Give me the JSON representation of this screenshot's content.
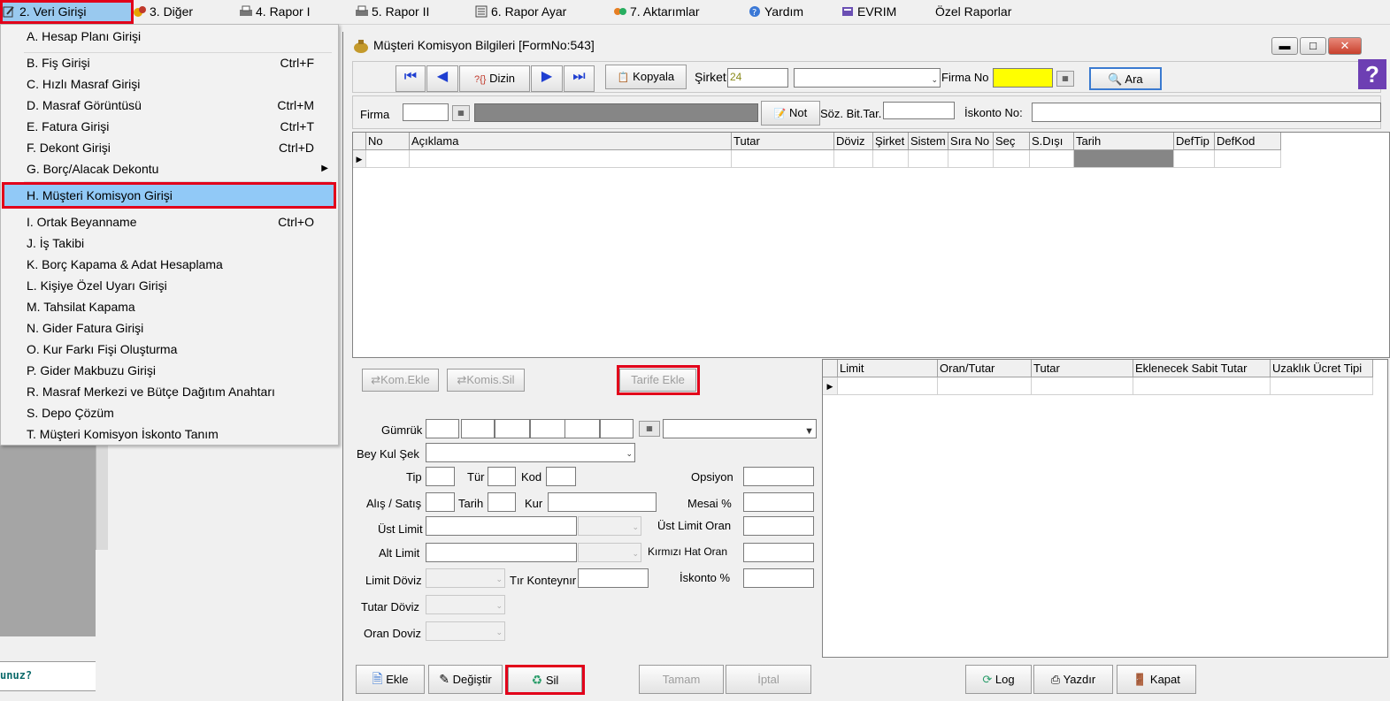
{
  "menubar": {
    "items": [
      {
        "label": "2.  Veri Girişi"
      },
      {
        "label": "3.  Diğer"
      },
      {
        "label": "4.   Rapor I"
      },
      {
        "label": "5.   Rapor II"
      },
      {
        "label": "6.   Rapor Ayar"
      },
      {
        "label": "7.   Aktarımlar"
      },
      {
        "label": "Yardım"
      },
      {
        "label": "EVRIM"
      },
      {
        "label": "Özel Raporlar"
      }
    ]
  },
  "menu": {
    "items": [
      {
        "label": "A.  Hesap Planı Girişi",
        "shortcut": ""
      },
      {
        "label": "B.  Fiş Girişi",
        "shortcut": "Ctrl+F"
      },
      {
        "label": "C.  Hızlı Masraf Girişi",
        "shortcut": ""
      },
      {
        "label": "D.  Masraf Görüntüsü",
        "shortcut": "Ctrl+M"
      },
      {
        "label": "E.   Fatura Girişi",
        "shortcut": "Ctrl+T"
      },
      {
        "label": "F.   Dekont Girişi",
        "shortcut": "Ctrl+D"
      },
      {
        "label": "G.  Borç/Alacak Dekontu",
        "shortcut": ""
      },
      {
        "label": "H.   Müşteri Komisyon Girişi",
        "shortcut": ""
      },
      {
        "label": "I.   Ortak Beyanname",
        "shortcut": "Ctrl+O"
      },
      {
        "label": "J.   İş Takibi",
        "shortcut": ""
      },
      {
        "label": "K.   Borç Kapama & Adat Hesaplama",
        "shortcut": ""
      },
      {
        "label": "L.   Kişiye Özel Uyarı Girişi",
        "shortcut": ""
      },
      {
        "label": "M.  Tahsilat Kapama",
        "shortcut": ""
      },
      {
        "label": "N. Gider Fatura Girişi",
        "shortcut": ""
      },
      {
        "label": "O. Kur Farkı Fişi Oluşturma",
        "shortcut": ""
      },
      {
        "label": "P. Gider Makbuzu Girişi",
        "shortcut": ""
      },
      {
        "label": "R. Masraf Merkezi ve Bütçe Dağıtım Anahtarı",
        "shortcut": ""
      },
      {
        "label": "S. Depo Çözüm",
        "shortcut": ""
      },
      {
        "label": "T. Müşteri Komisyon İskonto Tanım",
        "shortcut": ""
      }
    ]
  },
  "left_fragment": "unuz?",
  "window": {
    "title": "Müşteri Komisyon Bilgileri [FormNo:543]",
    "toolbar": {
      "dizin": "Dizin",
      "kopyala": "Kopyala",
      "sirket_label": "Şirket",
      "sirket_value": "24",
      "firma_no_label": "Firma No",
      "ara": "Ara"
    },
    "row2": {
      "firma_label": "Firma",
      "not_button": "Not",
      "soz_label": "Söz. Bit.Tar.",
      "iskonto_label": "İskonto No:"
    },
    "main_grid": {
      "columns": [
        "No",
        "Açıklama",
        "Tutar",
        "Döviz",
        "Şirket",
        "Sistem",
        "Sıra No",
        "Seç",
        "S.Dışı",
        "Tarih",
        "DefTip",
        "DefKod"
      ]
    },
    "buttons_mid": {
      "kom_ekle": "Kom.Ekle",
      "komis_sil": "Komis.Sil",
      "tarife_ekle": "Tarife Ekle"
    },
    "form": {
      "gumruk": "Gümrük",
      "bey_kul_sek": "Bey Kul Şek",
      "tip": "Tip",
      "tur": "Tür",
      "kod": "Kod",
      "opsiyon": "Opsiyon",
      "alis_satis": "Alış / Satış",
      "tarih": "Tarih",
      "kur": "Kur",
      "mesai": "Mesai %",
      "ust_limit": "Üst Limit",
      "ust_limit_oran": "Üst Limit Oran",
      "alt_limit": "Alt Limit",
      "kirmizi_hat_oran": "Kırmızı Hat Oran",
      "limit_doviz": "Limit Döviz",
      "tir_konteynir": "Tır Konteynır",
      "iskonto_pct": "İskonto %",
      "tutar_doviz": "Tutar Döviz",
      "oran_doviz": "Oran Doviz"
    },
    "sub_grid": {
      "columns": [
        "Limit",
        "Oran/Tutar",
        "Tutar",
        "Eklenecek Sabit Tutar",
        "Uzaklık Ücret Tipi"
      ]
    },
    "bottom": {
      "ekle": "Ekle",
      "degistir": "Değiştir",
      "sil": "Sil",
      "tamam": "Tamam",
      "iptal": "İptal",
      "log": "Log",
      "yazdir": "Yazdır",
      "kapat": "Kapat"
    }
  },
  "colors": {
    "highlight": "#91c9f7",
    "annotation_red": "#e2001a",
    "firma_no_bg": "#ffff00",
    "nav_blue": "#1f3fd1"
  }
}
